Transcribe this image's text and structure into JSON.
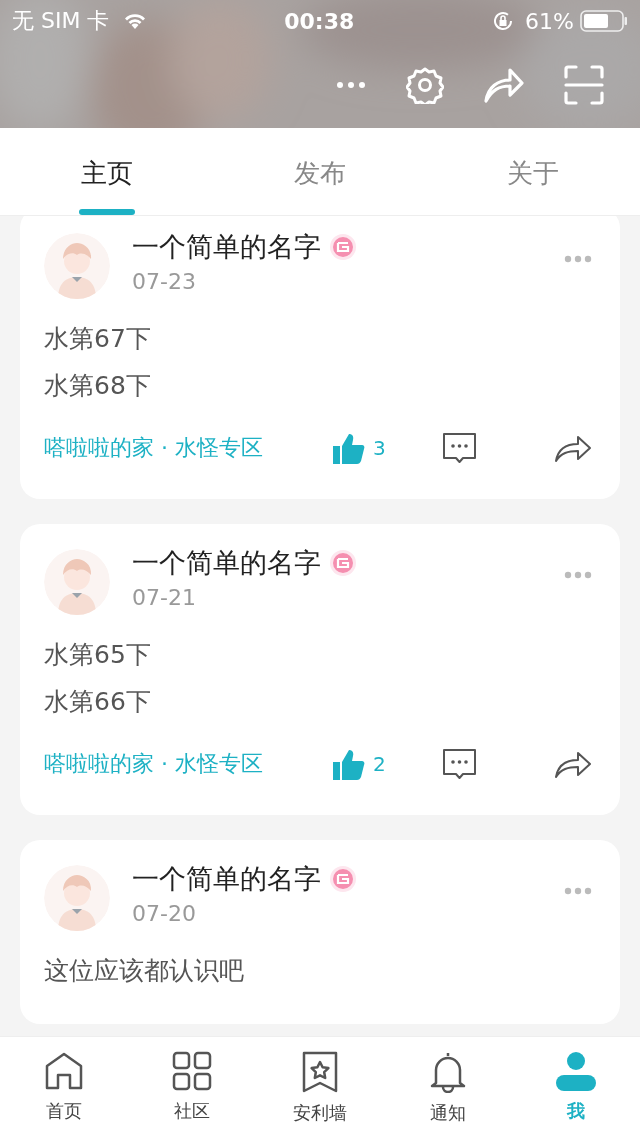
{
  "status_bar": {
    "carrier": "无 SIM 卡",
    "time": "00:38",
    "battery": "61%"
  },
  "tabs": [
    {
      "label": "主页",
      "selected": true
    },
    {
      "label": "发布",
      "selected": false
    },
    {
      "label": "关于",
      "selected": false
    }
  ],
  "posts": [
    {
      "author": "一个简单的名字",
      "date": "07-23",
      "lines": [
        "水第67下",
        "水第68下"
      ],
      "community": "嗒啦啦的家 · 水怪专区",
      "likes": "3"
    },
    {
      "author": "一个简单的名字",
      "date": "07-21",
      "lines": [
        "水第65下",
        "水第66下"
      ],
      "community": "嗒啦啦的家 · 水怪专区",
      "likes": "2"
    },
    {
      "author": "一个简单的名字",
      "date": "07-20",
      "lines": [
        "这位应该都认识吧"
      ]
    }
  ],
  "nav": [
    {
      "label": "首页",
      "selected": false
    },
    {
      "label": "社区",
      "selected": false
    },
    {
      "label": "安利墙",
      "selected": false
    },
    {
      "label": "通知",
      "selected": false
    },
    {
      "label": "我",
      "selected": true
    }
  ]
}
